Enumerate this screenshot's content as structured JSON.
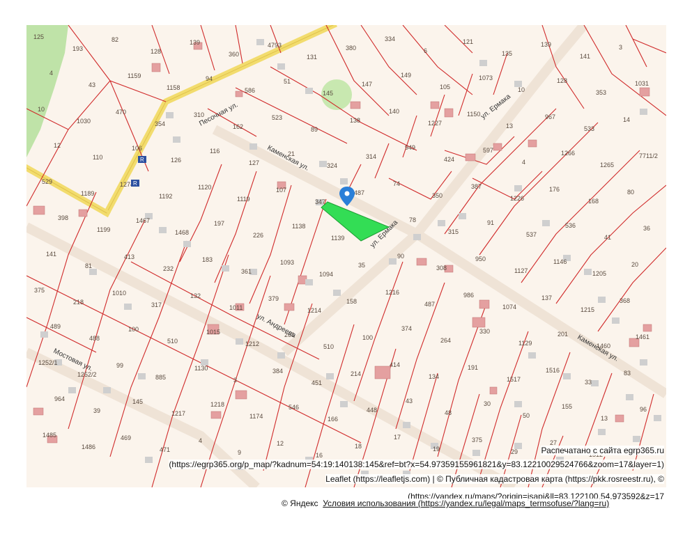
{
  "map": {
    "selected_parcel_color": "#33dd55",
    "marker_color": "#2a7fd8",
    "road_color": "#f2dc6e",
    "boundary_color": "#d02a2a",
    "background_color": "#fbf4ec",
    "building_color": "#d98a8a",
    "streets": {
      "pesochnaya": "Песочная ул.",
      "kamenskaya_top": "Каменская ул.",
      "kamenskaya_bottom": "Каменская ул.",
      "ermaka_top": "ул. Ермака",
      "ermaka_mid": "ул. Ермака",
      "andreeva": "ул. Андреева",
      "mostovaya": "Мостовая ул."
    },
    "road_shield": "R",
    "plot_numbers": [
      "125",
      "193",
      "82",
      "128",
      "139",
      "360",
      "4793",
      "131",
      "380",
      "334",
      "6",
      "121",
      "135",
      "139",
      "141",
      "3",
      "4",
      "43",
      "1159",
      "1158",
      "94",
      "586",
      "51",
      "145",
      "147",
      "149",
      "105",
      "1073",
      "10",
      "128",
      "353",
      "1031",
      "10",
      "1030",
      "470",
      "354",
      "310",
      "162",
      "523",
      "89",
      "138",
      "140",
      "1227",
      "1150",
      "13",
      "967",
      "533",
      "14",
      "12",
      "110",
      "106",
      "126",
      "116",
      "127",
      "21",
      "324",
      "314",
      "949",
      "424",
      "597",
      "4",
      "1266",
      "1265",
      "7711/2",
      "529",
      "1189",
      "1274",
      "1192",
      "1120",
      "1119",
      "107",
      "347",
      "487",
      "74",
      "350",
      "387",
      "1226",
      "176",
      "168",
      "80",
      "398",
      "1199",
      "1467",
      "1468",
      "197",
      "226",
      "1138",
      "1139",
      "234",
      "78",
      "315",
      "91",
      "537",
      "536",
      "41",
      "36",
      "141",
      "81",
      "413",
      "232",
      "183",
      "361",
      "1093",
      "1094",
      "35",
      "90",
      "308",
      "950",
      "1127",
      "1146",
      "1205",
      "20",
      "375",
      "218",
      "1010",
      "317",
      "132",
      "1011",
      "379",
      "1214",
      "158",
      "1216",
      "487",
      "986",
      "1074",
      "137",
      "1215",
      "368",
      "489",
      "488",
      "100",
      "510",
      "1015",
      "1212",
      "261",
      "510",
      "100",
      "374",
      "264",
      "330",
      "1129",
      "201",
      "1460",
      "1461",
      "1252/1",
      "1252/2",
      "99",
      "885",
      "1130",
      "3",
      "384",
      "451",
      "214",
      "414",
      "134",
      "191",
      "1517",
      "1516",
      "33",
      "83",
      "964",
      "39",
      "145",
      "1217",
      "1218",
      "1174",
      "546",
      "166",
      "448",
      "43",
      "48",
      "30",
      "50",
      "155",
      "13",
      "96",
      "1485",
      "1486",
      "469",
      "471",
      "4",
      "9",
      "12",
      "16",
      "18",
      "17",
      "19",
      "375",
      "29",
      "27",
      "1512"
    ]
  },
  "attribution": {
    "printed_from": "Распечатано с сайта egrp365.ru",
    "source_url": "(https://egrp365.org/p_map/?kadnum=54:19:140138:145&ref=bt?x=54.97359155961821&y=83.12210029524766&zoom=17&layer=1)",
    "leaflet": "Leaflet (https://leafletjs.com) | © Публичная кадастровая карта (https://pkk.rosreestr.ru), ©",
    "yandex_url": "(https://yandex.ru/maps/?origin=jsapi&ll=83.122100,54.973592&z=17",
    "yandex_copy": "© Яндекс",
    "terms": "Условия использования (https://yandex.ru/legal/maps_termsofuse/?lang=ru)"
  }
}
